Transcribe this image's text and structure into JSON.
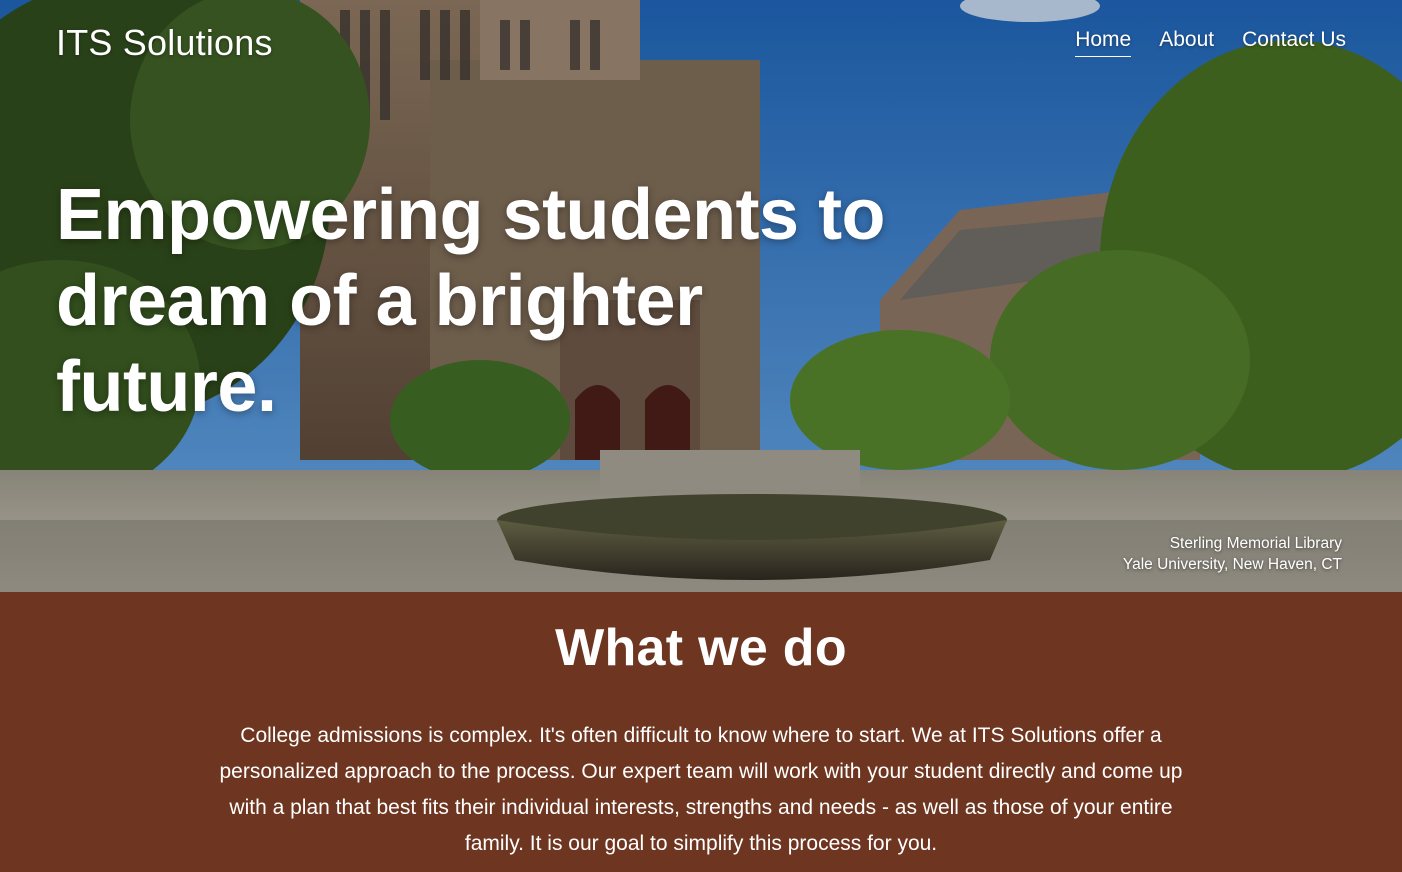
{
  "site": {
    "logo": "ITS Solutions"
  },
  "nav": {
    "items": [
      {
        "label": "Home",
        "active": true
      },
      {
        "label": "About",
        "active": false
      },
      {
        "label": "Contact Us",
        "active": false
      }
    ]
  },
  "hero": {
    "headline_line1": "Empowering students to",
    "headline_line2": "dream of a brighter future.",
    "caption_line1": "Sterling Memorial Library",
    "caption_line2": "Yale University, New Haven, CT"
  },
  "what_we_do": {
    "title": "What we do",
    "body": "College admissions is complex. It's often difficult to know where to start. We at ITS Solutions offer a personalized approach to the process. Our expert team will work with your student directly and come up with a plan that best fits their individual interests, strengths and needs - as well as those of your entire family. It is our goal to simplify this process for you."
  },
  "colors": {
    "section_bg": "#6e3621",
    "text": "#ffffff"
  }
}
